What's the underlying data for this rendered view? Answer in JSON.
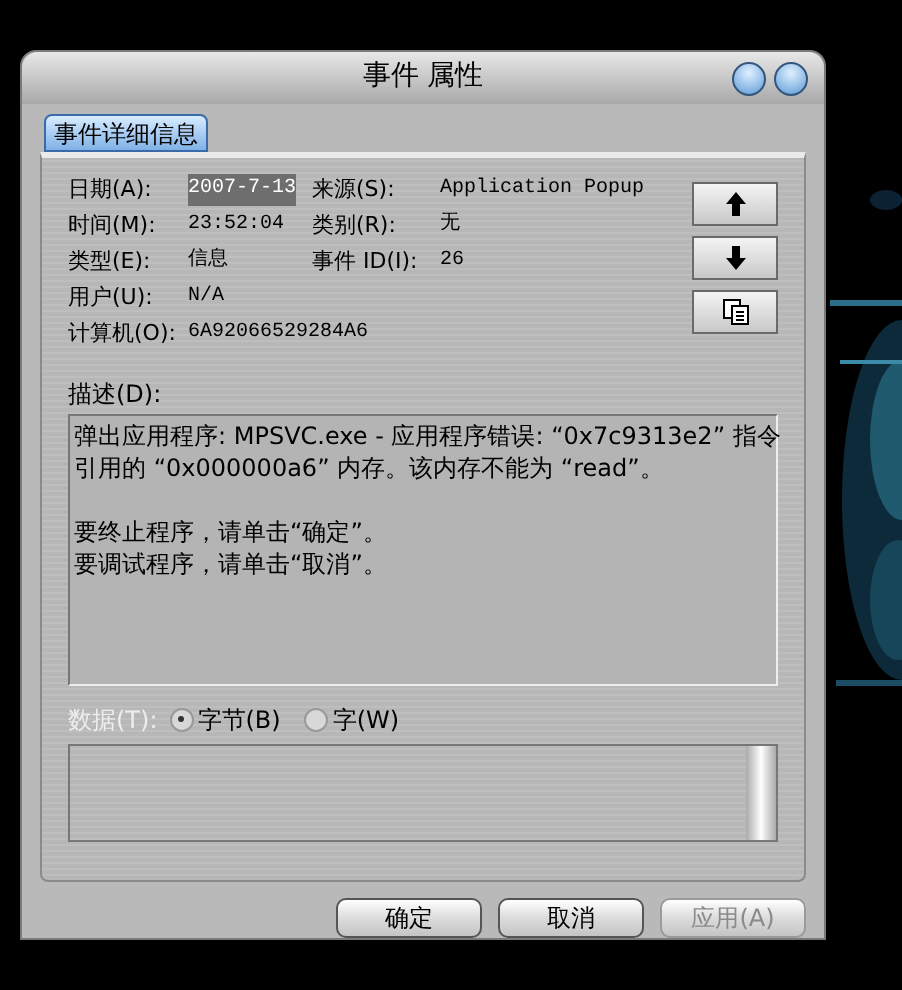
{
  "window": {
    "title": "事件 属性"
  },
  "tabs": [
    {
      "label": "事件详细信息",
      "selected": true
    }
  ],
  "fields": [
    {
      "label": "日期(A):",
      "value": "2007-7-13",
      "selected": true
    },
    {
      "label": "来源(S):",
      "value": "Application Popup",
      "selected": false
    },
    {
      "label": "时间(M):",
      "value": "23:52:04",
      "selected": false
    },
    {
      "label": "类别(R):",
      "value": "无",
      "selected": false
    },
    {
      "label": "类型(E):",
      "value": "信息",
      "selected": false
    },
    {
      "label": "事件 ID(I):",
      "value": "26",
      "selected": false
    },
    {
      "label": "用户(U):",
      "value": "N/A",
      "selected": false
    }
  ],
  "computer": {
    "label": "计算机(O):",
    "value": "6A92066529284A6"
  },
  "side_buttons": [
    {
      "kind": "up"
    },
    {
      "kind": "down"
    },
    {
      "kind": "copy"
    }
  ],
  "description": {
    "label": "描述(D):",
    "paragraphs": [
      [
        "弹出应用程序: MPSVC.exe - 应用程序错误: “0x7c9313e2” 指令",
        "引用的 “0x000000a6” 内存。该内存不能为 “read”。"
      ],
      [
        "要终止程序，请单击“确定”。",
        "要调试程序，请单击“取消”。"
      ]
    ]
  },
  "data": {
    "label": "数据(T):",
    "disabled": true,
    "options": [
      {
        "label": "字节(B)",
        "selected": true
      },
      {
        "label": "字(W)",
        "selected": false
      }
    ]
  },
  "buttons": [
    {
      "label": "确定",
      "disabled": false
    },
    {
      "label": "取消",
      "disabled": false
    },
    {
      "label": "应用(A)",
      "disabled": true
    }
  ]
}
